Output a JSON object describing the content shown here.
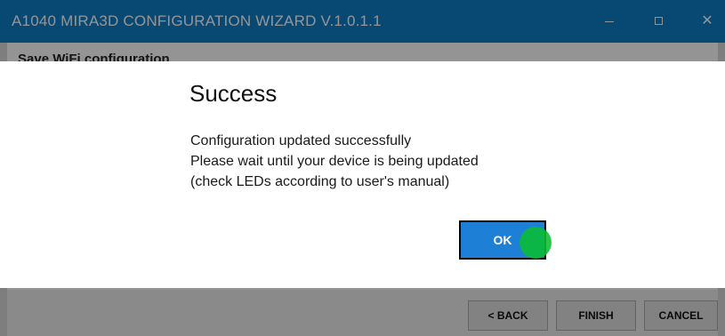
{
  "window": {
    "title": "A1040 MIRA3D CONFIGURATION WIZARD V.1.0.1.1",
    "minimize_glyph": "",
    "maximize_glyph": "",
    "close_glyph": "✕"
  },
  "page": {
    "section_title": "Save WiFi configuration"
  },
  "footer": {
    "back_label": "< BACK",
    "finish_label": "FINISH",
    "cancel_label": "CANCEL"
  },
  "dialog": {
    "title": "Success",
    "messages": [
      "Configuration updated successfully",
      "Please wait until your device is being updated",
      "(check LEDs according to user's manual)"
    ],
    "ok_label": "OK"
  },
  "colors": {
    "title_bar": "#0f7fc8",
    "ok_button": "#1e7fd6",
    "click_marker": "#0abe32"
  }
}
